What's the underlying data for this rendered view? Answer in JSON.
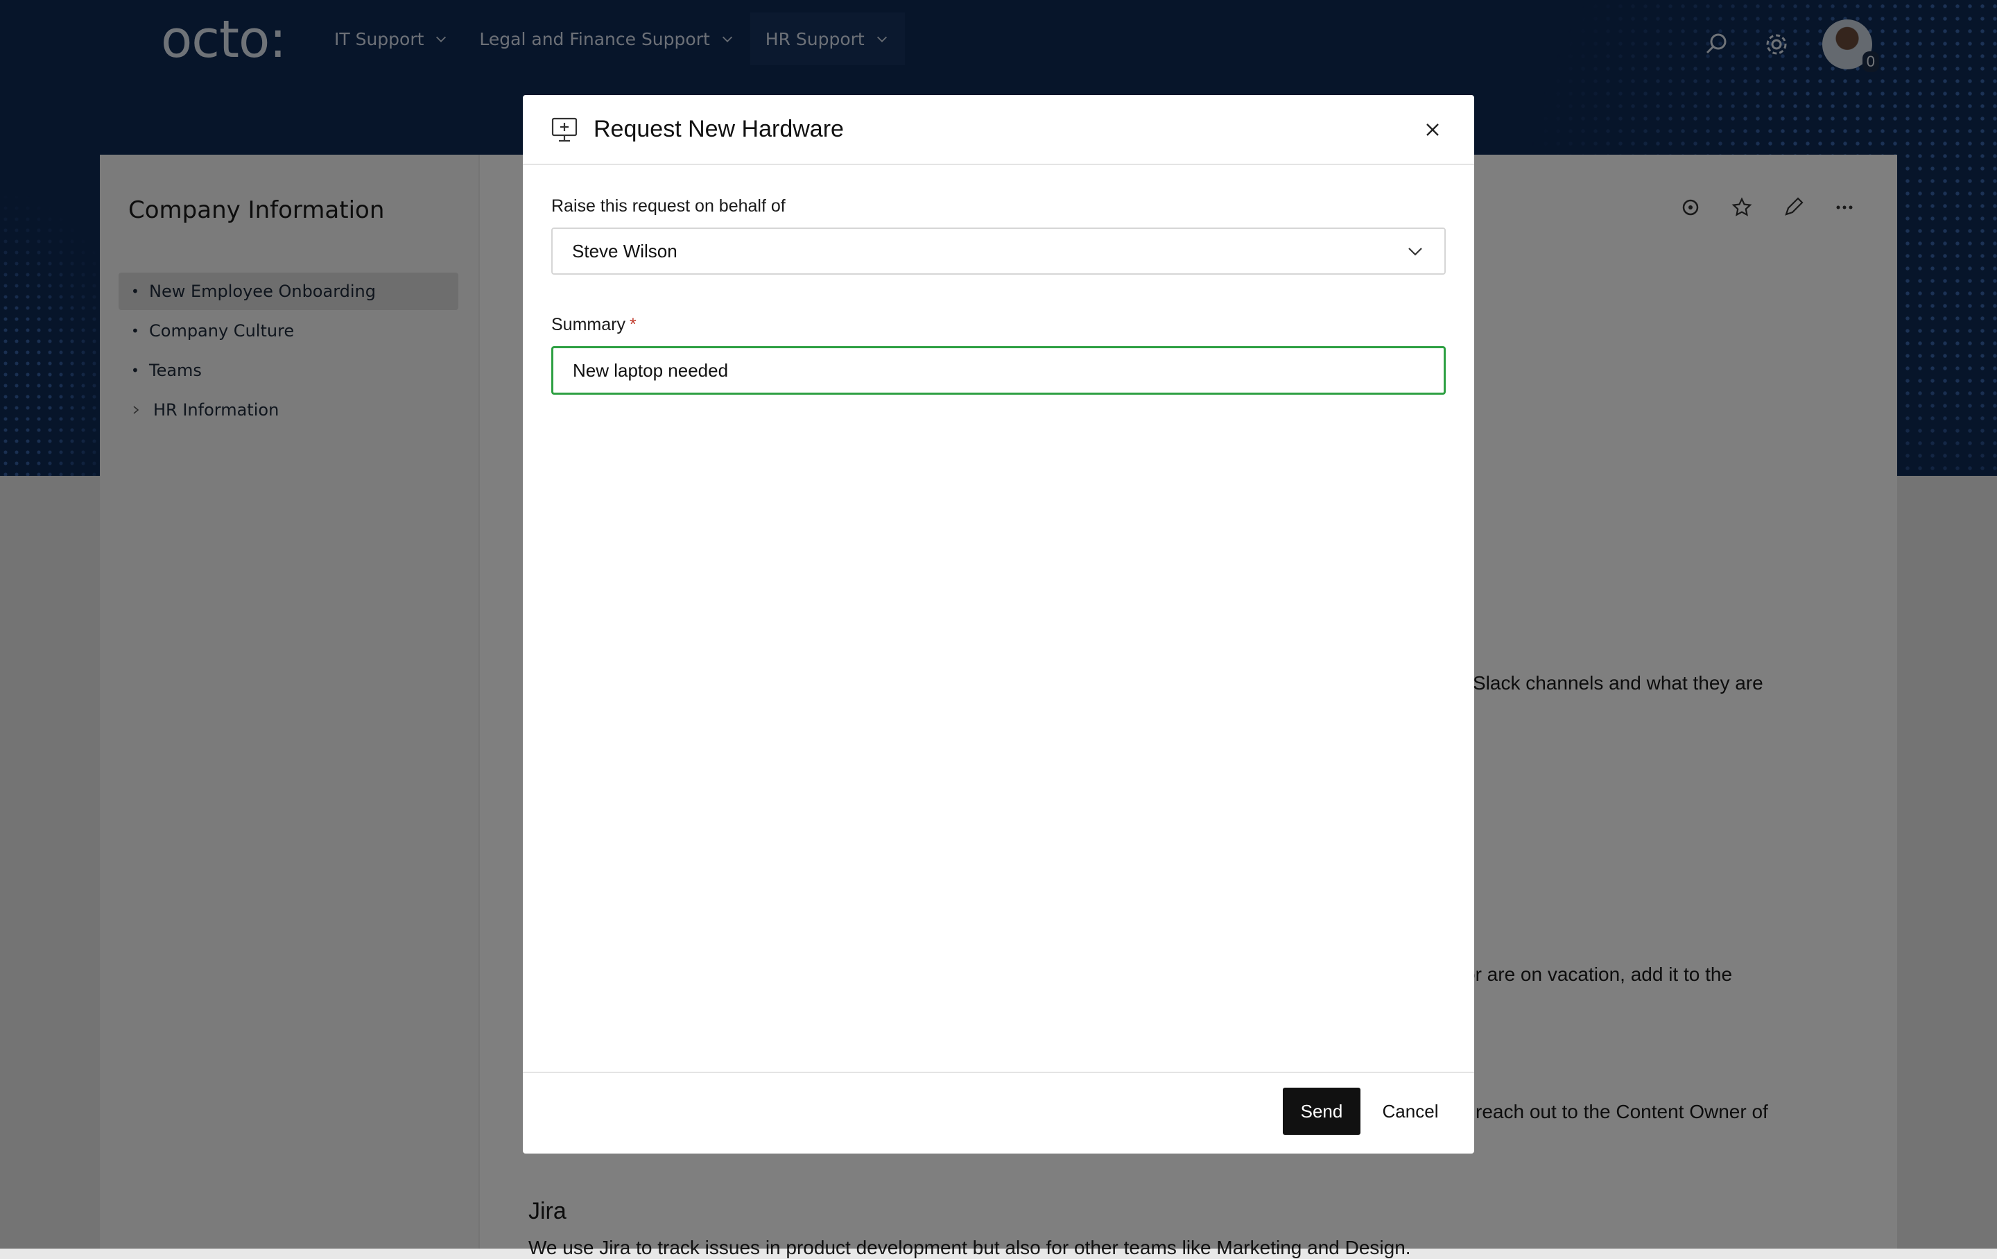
{
  "header": {
    "logo": "octo:",
    "nav": [
      {
        "label": "IT Support"
      },
      {
        "label": "Legal and Finance Support"
      },
      {
        "label": "HR Support"
      }
    ],
    "avatar_badge": "0",
    "icons": [
      "search-icon",
      "gear-icon",
      "avatar"
    ]
  },
  "sidebar": {
    "title": "Company Information",
    "items": [
      {
        "label": "New Employee Onboarding",
        "active": true
      },
      {
        "label": "Company Culture"
      },
      {
        "label": "Teams"
      },
      {
        "label": "HR Information",
        "expandable": true
      }
    ]
  },
  "page": {
    "tool_icons": [
      "watch-icon",
      "star-icon",
      "pencil-icon",
      "more-icon"
    ],
    "snippets": [
      "Slack channels and what they are",
      "or are on vacation, add it to the",
      "reach out to the Content Owner of"
    ],
    "heading_jira": "Jira",
    "jira_text": "We use Jira to track issues in product development but also for other teams like Marketing and Design."
  },
  "modal": {
    "title": "Request New Hardware",
    "behalf_label": "Raise this request on behalf of",
    "behalf_value": "Steve Wilson",
    "summary_label": "Summary",
    "required_mark": "*",
    "summary_value": "New laptop needed",
    "send_label": "Send",
    "cancel_label": "Cancel"
  },
  "colors": {
    "header_bg": "#0f2a55",
    "focus_border": "#2ea043",
    "primary_button": "#111111"
  }
}
